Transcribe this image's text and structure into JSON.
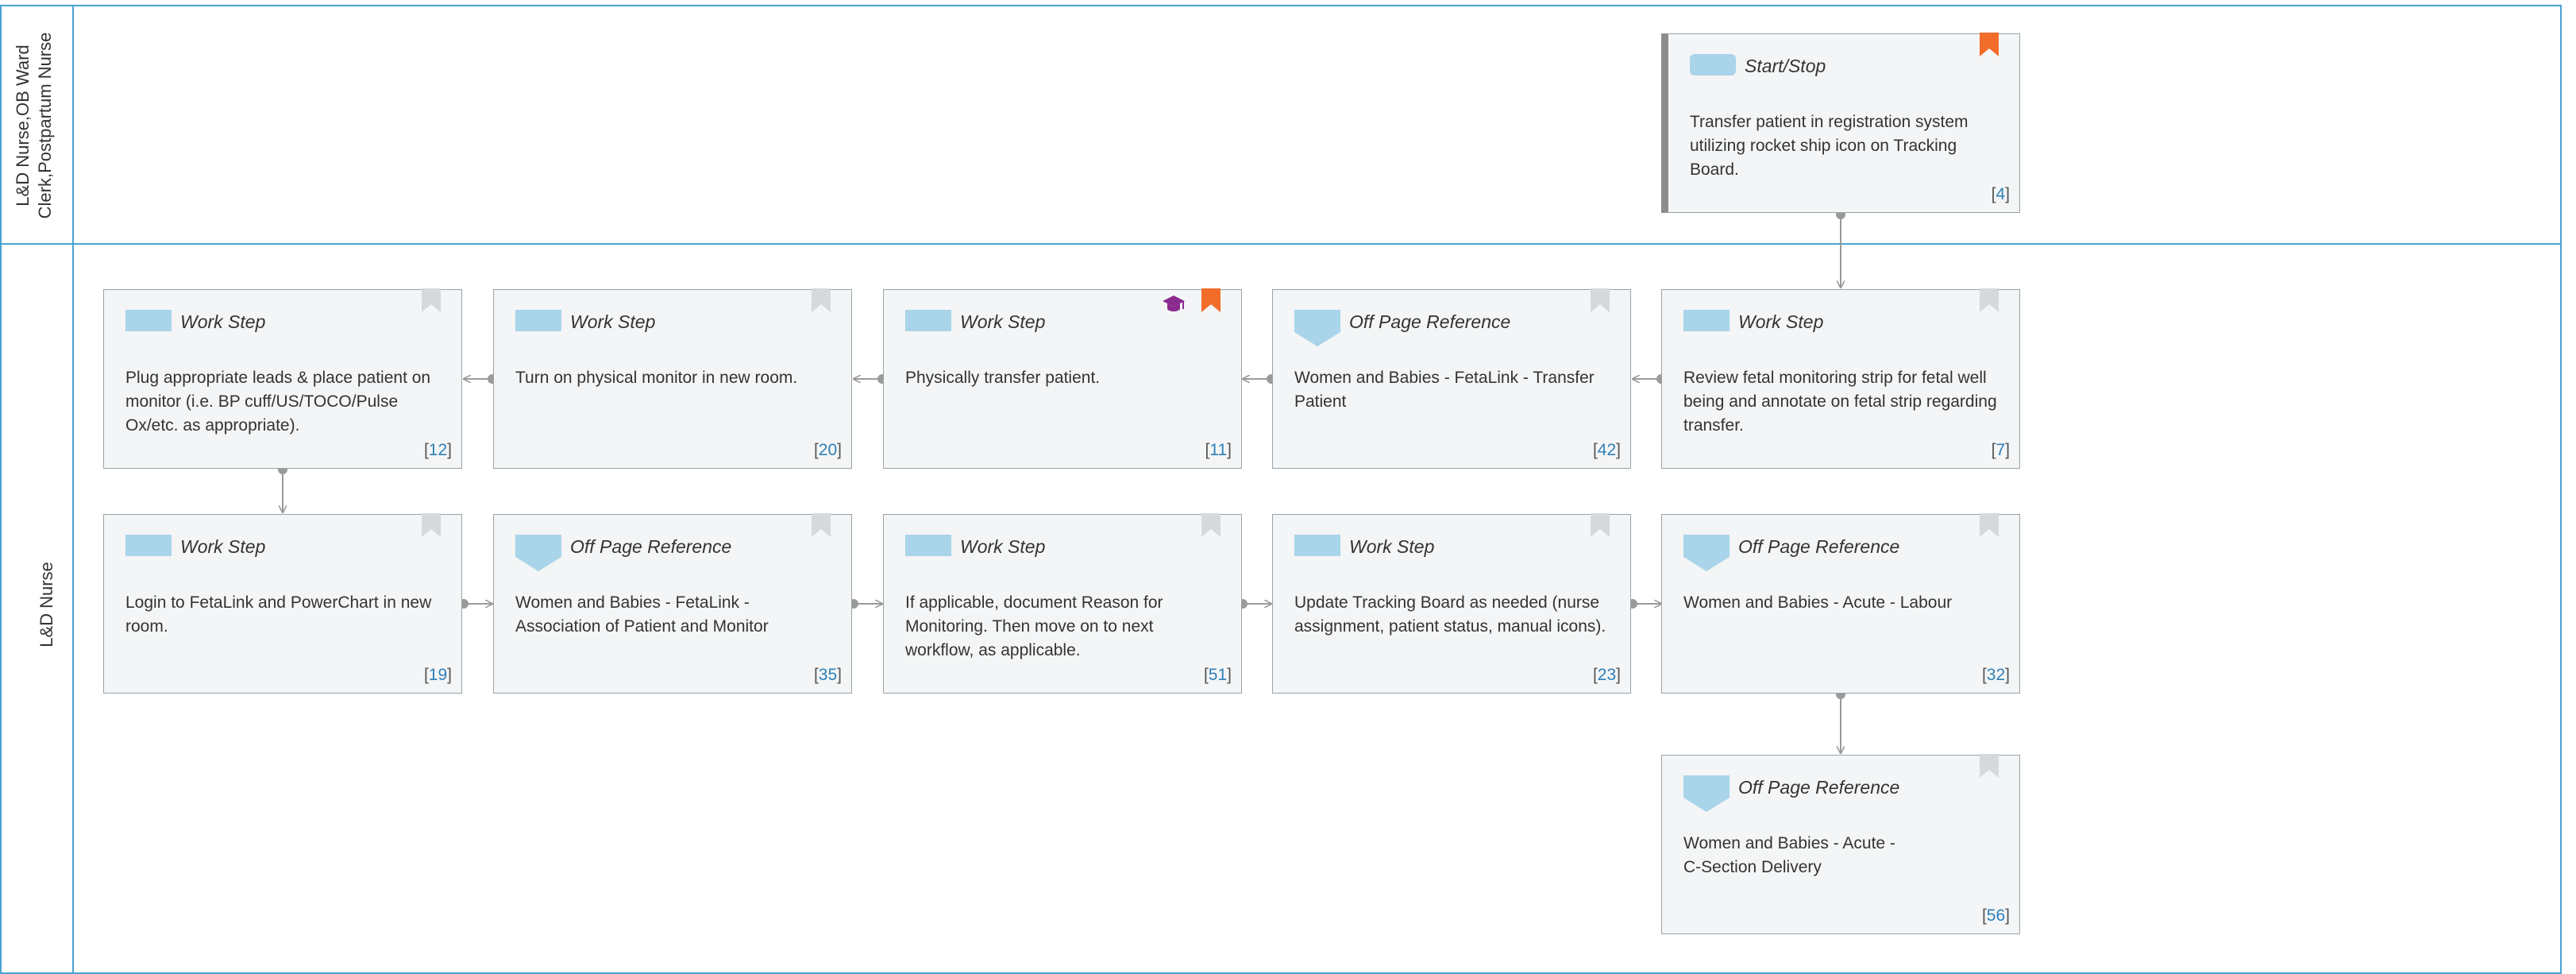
{
  "lanes": [
    {
      "id": "lane1",
      "label": "L&D Nurse,OB Ward\nClerk,Postpartum Nurse"
    },
    {
      "id": "lane2",
      "label": "L&D Nurse"
    }
  ],
  "cards": {
    "c4": {
      "type": "Start/Stop",
      "text": "Transfer patient in registration system utilizing rocket ship icon on Tracking Board.",
      "id": "4"
    },
    "c12": {
      "type": "Work Step",
      "text": "Plug appropriate leads & place patient on monitor (i.e. BP cuff/US/TOCO/Pulse Ox/etc. as appropriate).",
      "id": "12"
    },
    "c20": {
      "type": "Work Step",
      "text": "Turn on physical monitor in new room.",
      "id": "20"
    },
    "c11": {
      "type": "Work Step",
      "text": "Physically transfer patient.",
      "id": "11"
    },
    "c42": {
      "type": "Off Page Reference",
      "text": "Women and Babies - FetaLink  - Transfer Patient",
      "id": "42"
    },
    "c7": {
      "type": "Work Step",
      "text": "Review fetal monitoring strip for fetal well being and annotate on fetal strip regarding transfer.",
      "id": "7"
    },
    "c19": {
      "type": "Work Step",
      "text": "Login to FetaLink and PowerChart in new room.",
      "id": "19"
    },
    "c35": {
      "type": "Off Page Reference",
      "text": "Women and Babies - FetaLink - Association of Patient and Monitor",
      "id": "35"
    },
    "c51": {
      "type": "Work Step",
      "text": "If applicable, document Reason for Monitoring.  Then move on to next workflow, as applicable.",
      "id": "51"
    },
    "c23": {
      "type": "Work Step",
      "text": "Update Tracking Board as needed (nurse assignment, patient status, manual icons).",
      "id": "23"
    },
    "c32": {
      "type": "Off Page Reference",
      "text": "Women and Babies - Acute - Labour",
      "id": "32"
    },
    "c56": {
      "type": "Off Page Reference",
      "text": "Women and Babies - Acute -\nC-Section Delivery",
      "id": "56"
    }
  },
  "colors": {
    "lane_border": "#4ba3cf",
    "shape_fill": "#a9d4ea",
    "bookmark_active": "#f26c2a",
    "bookmark_inactive": "#d6d9dc",
    "cap": "#8a2a8f",
    "id_number": "#2f7fb7",
    "connector": "#9a9a9a"
  }
}
